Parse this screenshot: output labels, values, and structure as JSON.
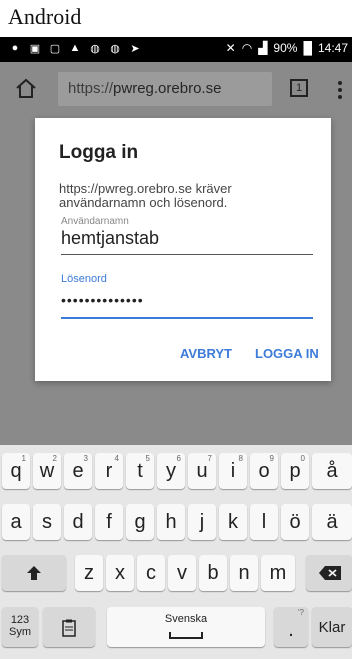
{
  "caption": "Android",
  "status_bar": {
    "battery": "90%",
    "time": "14:47"
  },
  "browser": {
    "url_prefix": "https://",
    "url_host": "pwreg.orebro.se",
    "tab_count": "1"
  },
  "dialog": {
    "title": "Logga in",
    "message": "https://pwreg.orebro.se kräver användarnamn och lösenord.",
    "username_label": "Användarnamn",
    "username_value": "hemtjanstab",
    "password_label": "Lösenord",
    "password_value": "••••••••••••••",
    "cancel_label": "AVBRYT",
    "login_label": "LOGGA IN"
  },
  "keyboard": {
    "row1": [
      {
        "key": "q",
        "hint": "1"
      },
      {
        "key": "w",
        "hint": "2"
      },
      {
        "key": "e",
        "hint": "3"
      },
      {
        "key": "r",
        "hint": "4"
      },
      {
        "key": "t",
        "hint": "5"
      },
      {
        "key": "y",
        "hint": "6"
      },
      {
        "key": "u",
        "hint": "7"
      },
      {
        "key": "i",
        "hint": "8"
      },
      {
        "key": "o",
        "hint": "9"
      },
      {
        "key": "p",
        "hint": "0"
      },
      {
        "key": "å",
        "hint": ""
      }
    ],
    "row2": [
      "a",
      "s",
      "d",
      "f",
      "g",
      "h",
      "j",
      "k",
      "l",
      "ö",
      "ä"
    ],
    "row3": [
      "z",
      "x",
      "c",
      "v",
      "b",
      "n",
      "m"
    ],
    "symbols_key": "123\nSym",
    "space_label": "Svenska",
    "period_key": ".",
    "period_hint": "'?",
    "clear_key": "Klar"
  }
}
